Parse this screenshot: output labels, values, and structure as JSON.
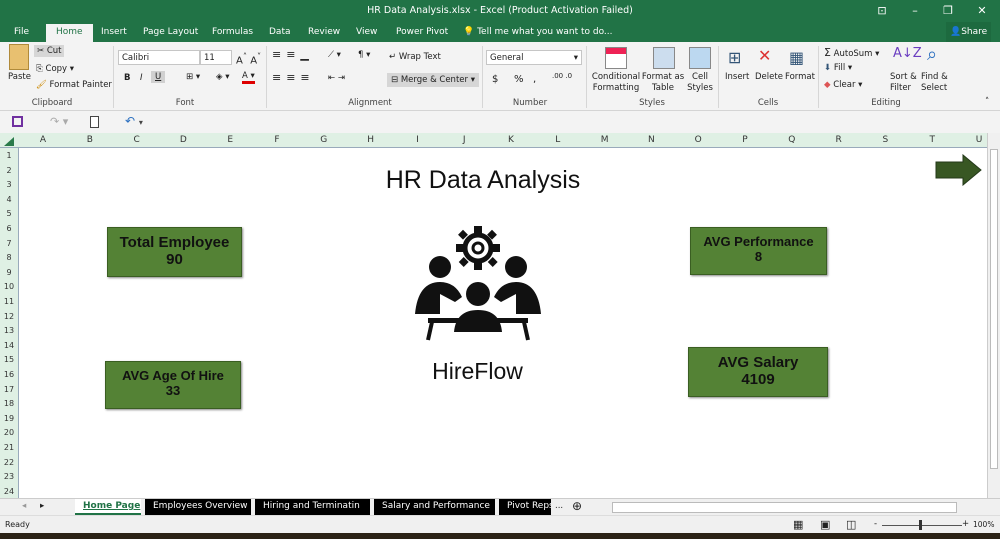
{
  "window": {
    "title": "HR Data Analysis.xlsx - Excel (Product Activation Failed)"
  },
  "ribbon_tabs": [
    "File",
    "Home",
    "Insert",
    "Page Layout",
    "Formulas",
    "Data",
    "Review",
    "View",
    "Power Pivot"
  ],
  "tell_me": "Tell me what you want to do...",
  "share": "Share",
  "clipboard": {
    "paste": "Paste",
    "cut": "Cut",
    "copy": "Copy",
    "format_painter": "Format Painter",
    "label": "Clipboard"
  },
  "font": {
    "name": "Calibri",
    "size": "11",
    "bold": "B",
    "italic": "I",
    "underline": "U",
    "label": "Font"
  },
  "alignment": {
    "wrap": "Wrap Text",
    "merge": "Merge & Center",
    "label": "Alignment"
  },
  "number": {
    "format": "General",
    "currency": "$",
    "percent": "%",
    "comma": ",",
    "label": "Number"
  },
  "styles": {
    "conditional": "Conditional Formatting",
    "format_table": "Format as Table",
    "cell_styles": "Cell Styles",
    "label": "Styles"
  },
  "cells": {
    "insert": "Insert",
    "delete": "Delete",
    "format": "Format",
    "label": "Cells"
  },
  "editing": {
    "autosum": "AutoSum",
    "fill": "Fill",
    "clear": "Clear",
    "sort": "Sort & Filter",
    "find": "Find & Select",
    "label": "Editing"
  },
  "columns": [
    "A",
    "B",
    "C",
    "D",
    "E",
    "F",
    "G",
    "H",
    "I",
    "J",
    "K",
    "L",
    "M",
    "N",
    "O",
    "P",
    "Q",
    "R",
    "S",
    "T",
    "U"
  ],
  "rows": [
    "1",
    "2",
    "3",
    "4",
    "5",
    "6",
    "7",
    "8",
    "9",
    "10",
    "11",
    "12",
    "13",
    "14",
    "15",
    "16",
    "17",
    "18",
    "19",
    "20",
    "21",
    "22",
    "23",
    "24"
  ],
  "dashboard": {
    "title": "HR Data Analysis",
    "brand": "HireFlow",
    "kpis": {
      "total_employee": {
        "label": "Total Employee",
        "value": "90"
      },
      "avg_age": {
        "label": "AVG Age Of Hire",
        "value": "33"
      },
      "avg_performance": {
        "label": "AVG Performance",
        "value": "8"
      },
      "avg_salary": {
        "label": "AVG Salary",
        "value": "4109"
      }
    },
    "kpi_color": "#548235"
  },
  "sheet_tabs": [
    "Home Page",
    "Employees Overview",
    "Hiring and Terminatin",
    "Salary and Performance",
    "Pivot Reps"
  ],
  "sheet_tabs_more": "...",
  "status": {
    "ready": "Ready",
    "zoom": "100%"
  }
}
